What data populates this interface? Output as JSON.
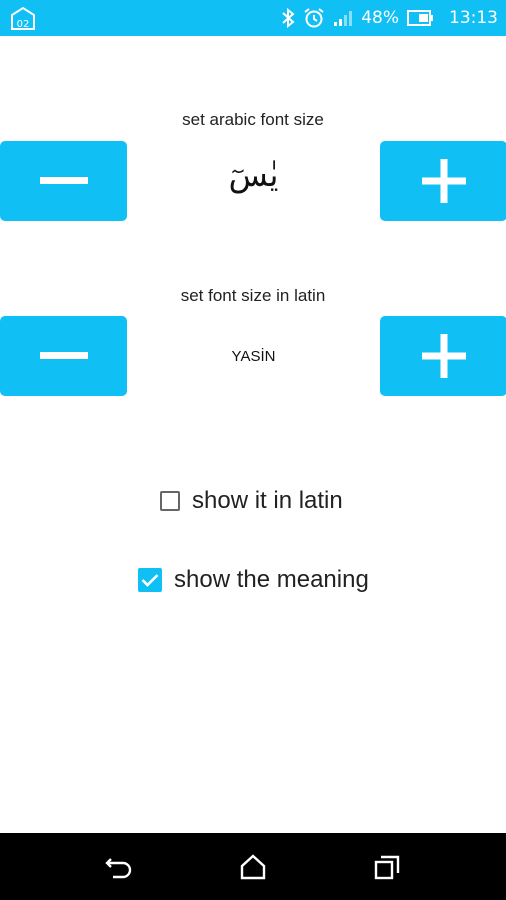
{
  "status_bar": {
    "app_badge": "02",
    "battery": "48%",
    "time": "13:13",
    "icons": [
      "app-icon",
      "bluetooth-icon",
      "alarm-icon",
      "signal-icon",
      "battery-icon"
    ],
    "color": "#10c0f5"
  },
  "arabic_section": {
    "label": "set arabic font size",
    "preview": "يٰسٓ",
    "decrease_icon": "minus-icon",
    "increase_icon": "plus-icon"
  },
  "latin_section": {
    "label": "set font size in latin",
    "preview": "YASİN",
    "decrease_icon": "minus-icon",
    "increase_icon": "plus-icon"
  },
  "options": {
    "show_latin": {
      "label": "show it in latin",
      "checked": false
    },
    "show_meaning": {
      "label": "show the meaning",
      "checked": true
    }
  },
  "nav_bar": {
    "icons": [
      "back-icon",
      "home-icon",
      "recents-icon"
    ]
  },
  "colors": {
    "accent": "#10c0f5",
    "nav": "#000000"
  }
}
